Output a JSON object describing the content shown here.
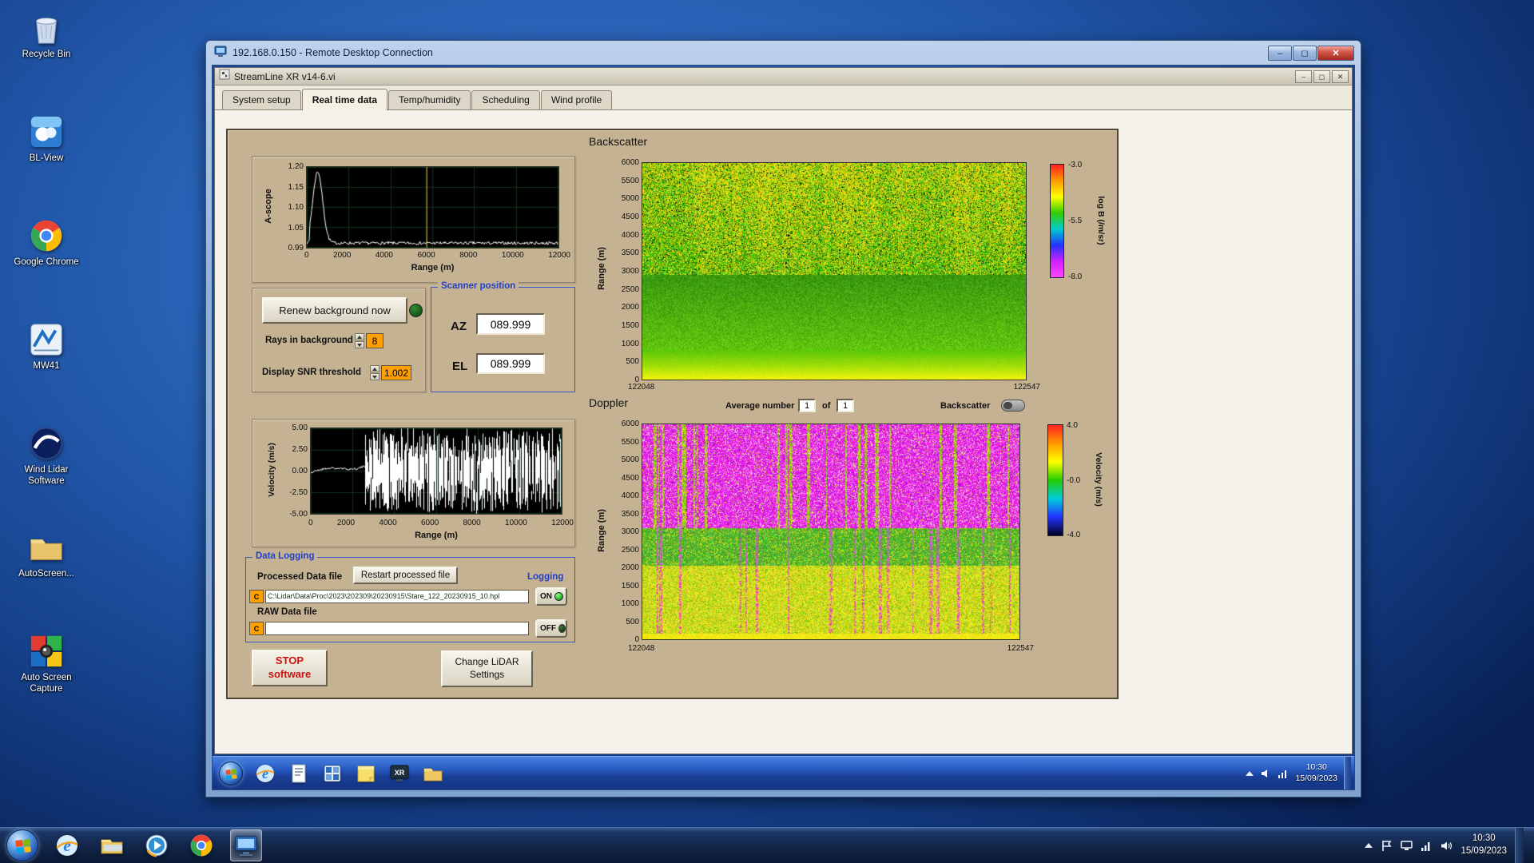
{
  "host": {
    "desktop_icons": [
      {
        "id": "recycle-bin",
        "label": "Recycle Bin"
      },
      {
        "id": "bl-view",
        "label": "BL-View"
      },
      {
        "id": "google-chrome",
        "label": "Google Chrome"
      },
      {
        "id": "mw41",
        "label": "MW41"
      },
      {
        "id": "wind-lidar",
        "label": "Wind Lidar Software"
      },
      {
        "id": "autoscreen",
        "label": "AutoScreen..."
      },
      {
        "id": "auto-screen-capture",
        "label": "Auto Screen Capture"
      }
    ],
    "taskbar": {
      "clock_time": "10:30",
      "clock_date": "15/09/2023"
    }
  },
  "rdc": {
    "title": "192.168.0.150 - Remote Desktop Connection",
    "remote_taskbar": {
      "clock_time": "10:30",
      "clock_date": "15/09/2023"
    }
  },
  "app": {
    "title": "StreamLine XR v14-6.vi",
    "tabs": [
      {
        "label": "System setup",
        "active": false
      },
      {
        "label": "Real time data",
        "active": true
      },
      {
        "label": "Temp/humidity",
        "active": false
      },
      {
        "label": "Scheduling",
        "active": false
      },
      {
        "label": "Wind profile",
        "active": false
      }
    ],
    "controls": {
      "renew_button": "Renew background now",
      "rays_label": "Rays in background",
      "rays_value": "8",
      "snr_label": "Display SNR threshold",
      "snr_value": "1.002",
      "scanner_title": "Scanner position",
      "az_label": "AZ",
      "az_value": "089.999",
      "el_label": "EL",
      "el_value": "089.999",
      "average_label": "Average number",
      "average_value": "1",
      "average_of": "of",
      "average_of_value": "1",
      "backscatter_toggle_label": "Backscatter"
    },
    "data_logging": {
      "title": "Data Logging",
      "processed_label": "Processed Data file",
      "restart_button": "Restart processed file",
      "logging_label": "Logging",
      "drive_letter": "C",
      "processed_path": "C:\\Lidar\\Data\\Proc\\2023\\202309\\20230915\\Stare_122_20230915_10.hpl",
      "on_label": "ON",
      "raw_label": "RAW Data file",
      "raw_path": "",
      "off_label": "OFF"
    },
    "buttons": {
      "stop_line1": "STOP",
      "stop_line2": "software",
      "change_line1": "Change LiDAR",
      "change_line2": "Settings"
    }
  },
  "chart_data": [
    {
      "id": "ascope",
      "type": "line",
      "ylabel": "A-scope",
      "xlabel": "Range (m)",
      "xlim": [
        0,
        12000
      ],
      "ylim": [
        0.99,
        1.2
      ],
      "yticks": [
        "1.20",
        "1.15",
        "1.10",
        "1.05",
        "0.99"
      ],
      "xticks": [
        "0",
        "2000",
        "4000",
        "6000",
        "8000",
        "10000",
        "12000"
      ],
      "series": [
        {
          "name": "a-scope",
          "description": "baseline 1.00 with sharp peak to 1.19 near range 500 m, decaying to 1.00 by 2000 m, flat noisy baseline out to 12000 m"
        }
      ],
      "cursor_x": 5700,
      "bg": "#000000",
      "trace_color": "#ffffff",
      "cursor_color": "#e6d84a"
    },
    {
      "id": "backscatter",
      "type": "heatmap",
      "title": "Backscatter",
      "ylabel": "Range (m)",
      "ylim": [
        0,
        6000
      ],
      "yticks": [
        "6000",
        "5500",
        "5000",
        "4500",
        "4000",
        "3500",
        "3000",
        "2500",
        "2000",
        "1500",
        "1000",
        "500",
        "0"
      ],
      "xticks": [
        "122048",
        "122547"
      ],
      "colorbar": {
        "label": "log B (/m/sr)",
        "ticks": [
          "-3.0",
          "-5.5",
          "-8.0"
        ],
        "gradient": [
          "#ff2222",
          "#ff9900",
          "#ffff00",
          "#33cc00",
          "#00cccc",
          "#2233ff",
          "#cc22ff",
          "#ff44ff"
        ]
      },
      "regions": [
        {
          "range_m": [
            3000,
            6000
          ],
          "desc": "speckled yellow/green noise with sparse dark pixels"
        },
        {
          "range_m": [
            700,
            3000
          ],
          "desc": "mostly green backscatter"
        },
        {
          "range_m": [
            0,
            700
          ],
          "desc": "bright yellow-green boundary-layer band"
        }
      ]
    },
    {
      "id": "velocity",
      "type": "line",
      "ylabel": "Velocity (m/s)",
      "xlabel": "Range (m)",
      "xlim": [
        0,
        12000
      ],
      "ylim": [
        -5,
        5
      ],
      "yticks": [
        "5.00",
        "2.50",
        "0.00",
        "-2.50",
        "-5.00"
      ],
      "xticks": [
        "0",
        "2000",
        "4000",
        "6000",
        "8000",
        "10000",
        "12000"
      ],
      "series": [
        {
          "name": "velocity",
          "description": "coherent trace near 0 m/s below 2600 m, dense uncorrelated noise spanning -5 to +5 m/s beyond 2600 m"
        }
      ],
      "bg": "#000000",
      "trace_color": "#ffffff"
    },
    {
      "id": "doppler",
      "type": "heatmap",
      "title": "Doppler",
      "ylabel": "Range (m)",
      "ylim": [
        0,
        6000
      ],
      "yticks": [
        "6000",
        "5500",
        "5000",
        "4500",
        "4000",
        "3500",
        "3000",
        "2500",
        "2000",
        "1500",
        "1000",
        "500",
        "0"
      ],
      "xticks": [
        "122048",
        "122547"
      ],
      "colorbar": {
        "label": "Velocity (m/s)",
        "ticks": [
          "4.0",
          "-0.0",
          "-4.0"
        ],
        "gradient": [
          "#ff2222",
          "#ff9900",
          "#ffff00",
          "#22cc00",
          "#00ccdd",
          "#2233ff",
          "#000022"
        ]
      },
      "regions": [
        {
          "range_m": [
            3100,
            6000
          ],
          "desc": "magenta/pink noise with vertical yellow-green streaks"
        },
        {
          "range_m": [
            2100,
            3100
          ],
          "desc": "green band with yellow speckle and magenta streaks"
        },
        {
          "range_m": [
            0,
            2100
          ],
          "desc": "yellow/lime zone with green speckle and sparse magenta columns"
        }
      ]
    }
  ]
}
